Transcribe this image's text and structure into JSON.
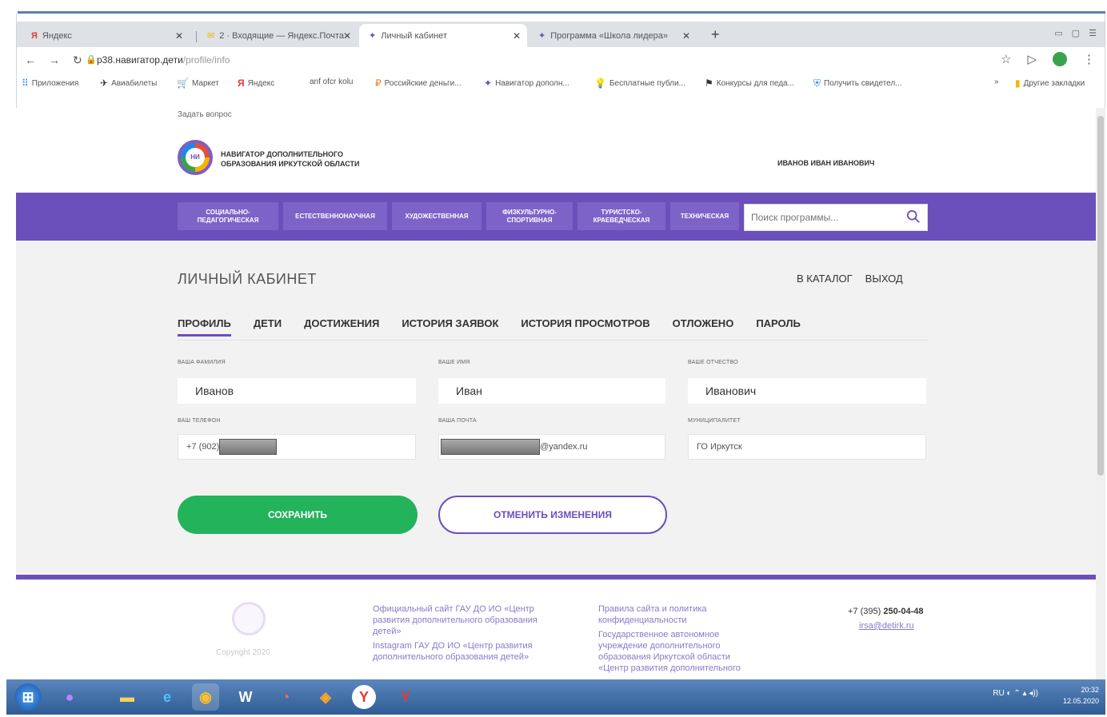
{
  "browser": {
    "tabs": [
      {
        "label": "Яндекс",
        "icon": "yandex-icon",
        "active": false
      },
      {
        "label": "2 · Входящие — Яндекс.Почта",
        "icon": "mail-icon",
        "active": false
      },
      {
        "label": "Личный кабинет",
        "icon": "navigator-icon",
        "active": true
      },
      {
        "label": "Программа «Школа лидера»",
        "icon": "navigator-icon",
        "active": false
      }
    ],
    "url_host": "p38.навигатор.дети",
    "url_path": "/profile/info",
    "bookmarks": [
      "Приложения",
      "Авиабилеты",
      "Маркет",
      "Яндекс",
      "аnf ofcr kolu",
      "Российские деньги...",
      "Навигатор дополн...",
      "Бесплатные публи...",
      "Конкурсы для педа...",
      "Получить свидетел...",
      "Другие закладки"
    ]
  },
  "page": {
    "ask_question": "Задать вопрос",
    "logo_text_line1": "НАВИГАТОР ДОПОЛНИТЕЛЬНОГО",
    "logo_text_line2": "ОБРАЗОВАНИЯ ИРКУТСКОЙ ОБЛАСТИ",
    "logo_abbr": "НИ",
    "user_name": "ИВАНОВ ИВАН ИВАНОВИЧ",
    "menu": [
      "СОЦИАЛЬНО-ПЕДАГОГИЧЕСКАЯ",
      "ЕСТЕСТВЕННОНАУЧНАЯ",
      "ХУДОЖЕСТВЕННАЯ",
      "ФИЗКУЛЬТУРНО-СПОРТИВНАЯ",
      "ТУРИСТСКО-КРАЕВЕДЧЕСКАЯ",
      "ТЕХНИЧЕСКАЯ"
    ],
    "search_placeholder": "Поиск программы...",
    "cabinet_title": "ЛИЧНЫЙ КАБИНЕТ",
    "catalog_link": "В КАТАЛОГ",
    "logout_link": "ВЫХОД",
    "profile_tabs": [
      "ПРОФИЛЬ",
      "ДЕТИ",
      "ДОСТИЖЕНИЯ",
      "ИСТОРИЯ ЗАЯВОК",
      "ИСТОРИЯ ПРОСМОТРОВ",
      "ОТЛОЖЕНО",
      "ПАРОЛЬ"
    ],
    "fields": {
      "surname_label": "ВАША ФАМИЛИЯ",
      "surname_value": "Иванов",
      "name_label": "ВАШЕ ИМЯ",
      "name_value": "Иван",
      "patronymic_label": "ВАШЕ ОТЧЕСТВО",
      "patronymic_value": "Иванович",
      "phone_label": "ВАШ ТЕЛЕФОН",
      "phone_value": "+7 (902)",
      "email_label": "ВАША ПОЧТА",
      "email_value": "@yandex.ru",
      "municipality_label": "МУНИЦИПАЛИТЕТ",
      "municipality_value": "ГО Иркутск"
    },
    "save_button": "СОХРАНИТЬ",
    "cancel_button": "ОТМЕНИТЬ ИЗМЕНЕНИЯ",
    "footer": {
      "copyright": "Copyright 2020",
      "col1_line1": "Официальный сайт ГАУ ДО ИО «Центр",
      "col1_line2": "развития дополнительного образования",
      "col1_line3": "детей»",
      "col1_line4": "Instagram ГАУ ДО ИО «Центр развития",
      "col1_line5": "дополнительного образования детей»",
      "col2_line1": "Правила сайта и политика",
      "col2_line2": "конфиденциальности",
      "col2_line3": "Государственное автономное",
      "col2_line4": "учреждение дополнительного",
      "col2_line5": "образования Иркутской области",
      "col2_line6": "«Центр развития дополнительного",
      "phone_prefix": "+7 (395) ",
      "phone_number": "250-04-48",
      "email": "irsa@detirk.ru"
    }
  },
  "taskbar": {
    "time": "20:32",
    "date": "12.05.2020",
    "lang": "RU"
  }
}
